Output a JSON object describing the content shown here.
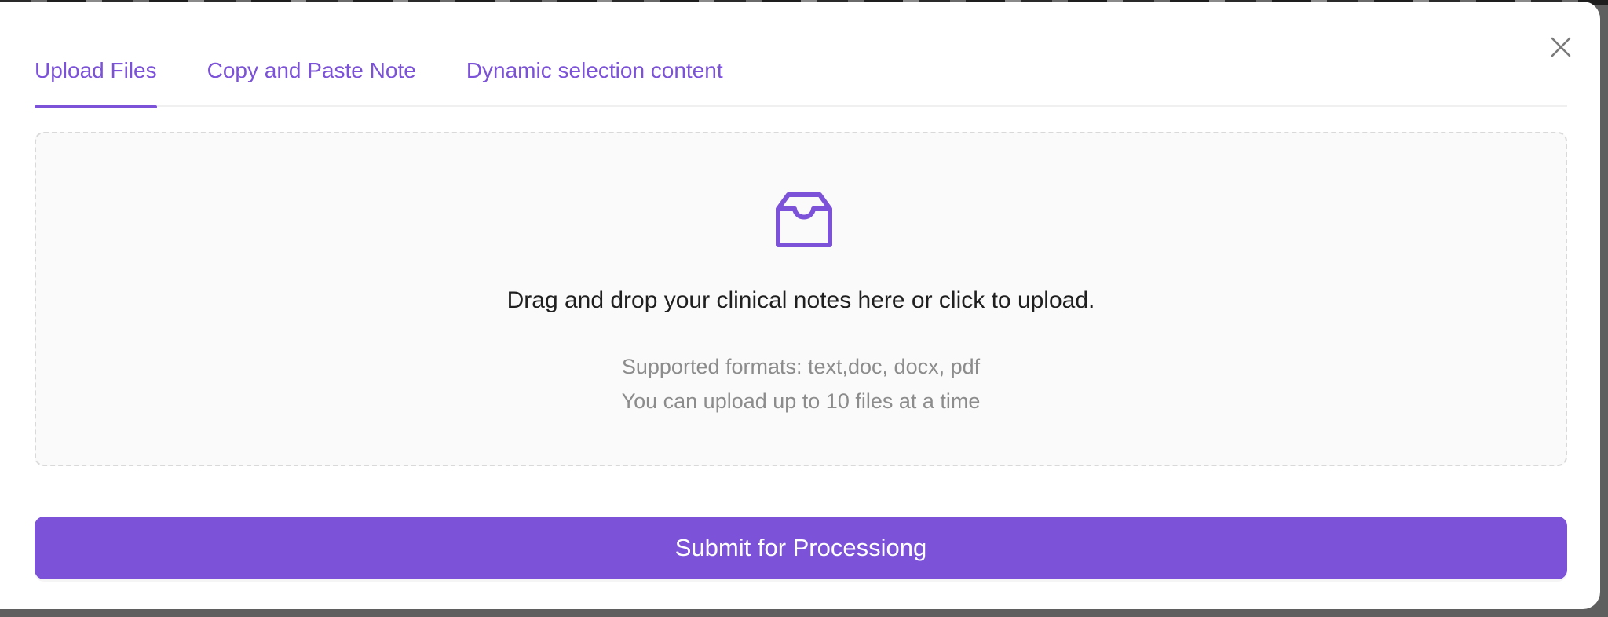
{
  "tabs": [
    {
      "label": "Upload Files",
      "active": true
    },
    {
      "label": "Copy and Paste Note",
      "active": false
    },
    {
      "label": "Dynamic selection content",
      "active": false
    }
  ],
  "dropzone": {
    "icon": "inbox-icon",
    "main_text": "Drag and drop your clinical notes here or click to upload.",
    "formats_hint": "Supported formats: text,doc, docx, pdf",
    "limit_hint": "You can upload up to 10 files at a time"
  },
  "submit": {
    "label": "Submit for Processiong"
  },
  "close": {
    "icon": "close-icon"
  },
  "colors": {
    "accent": "#7b52d8",
    "muted_text": "#8c8c8c",
    "dropzone_bg": "#fafafa"
  }
}
